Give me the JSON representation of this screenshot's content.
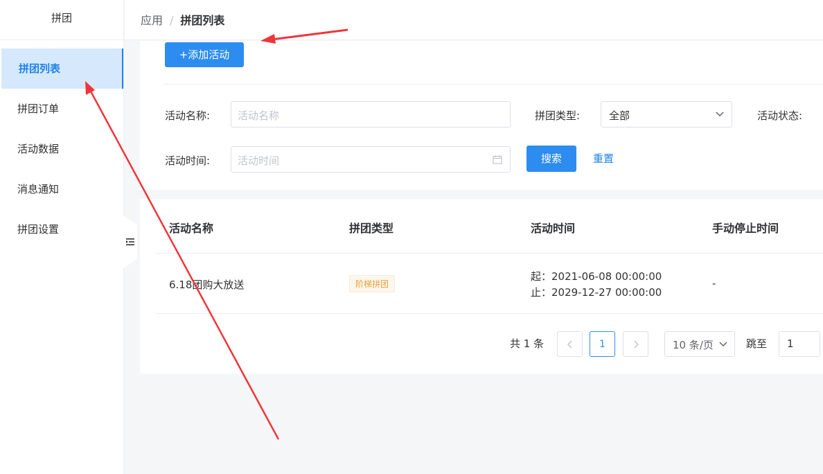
{
  "sidebar": {
    "app_title": "拼团",
    "items": [
      {
        "label": "拼团列表"
      },
      {
        "label": "拼团订单"
      },
      {
        "label": "活动数据"
      },
      {
        "label": "消息通知"
      },
      {
        "label": "拼团设置"
      }
    ]
  },
  "breadcrumb": {
    "parent": "应用",
    "separator": "/",
    "current": "拼团列表"
  },
  "toolbar": {
    "add_label": "+添加活动"
  },
  "filters": {
    "name_label": "活动名称:",
    "name_placeholder": "活动名称",
    "type_label": "拼团类型:",
    "type_value": "全部",
    "status_label": "活动状态:",
    "time_label": "活动时间:",
    "time_placeholder": "活动时间",
    "search_label": "搜索",
    "reset_label": "重置"
  },
  "table": {
    "headers": [
      "活动名称",
      "拼团类型",
      "活动时间",
      "手动停止时间"
    ],
    "rows": [
      {
        "name": "6.18团购大放送",
        "type": "阶梯拼团",
        "start": "起：2021-06-08 00:00:00",
        "end": "止：2029-12-27 00:00:00",
        "stop_time": "-"
      }
    ]
  },
  "pagination": {
    "total": "共 1 条",
    "current_page": "1",
    "page_size": "10 条/页",
    "jump_label": "跳至",
    "jump_value": "1"
  },
  "colors": {
    "primary": "#2d8cf0",
    "active_bg": "#d5e8fc",
    "tag_text": "#e6a23c",
    "annotation": "#f0353a"
  }
}
